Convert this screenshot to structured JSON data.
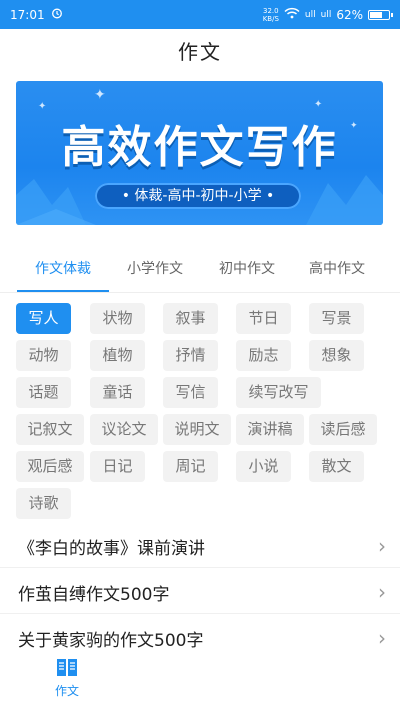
{
  "status_bar": {
    "time": "17:01",
    "alarm_icon": "alarm-icon",
    "net_speed_value": "32.0",
    "net_speed_unit": "KB/S",
    "wifi_icon": "wifi-icon",
    "signal_1": "ull",
    "signal_2": "ull",
    "battery": "62%"
  },
  "page": {
    "title": "作文"
  },
  "banner": {
    "headline": "高效作文写作",
    "subline": "• 体裁-高中-初中-小学 •"
  },
  "tabs": [
    {
      "label": "作文体裁",
      "active": true
    },
    {
      "label": "小学作文",
      "active": false
    },
    {
      "label": "初中作文",
      "active": false
    },
    {
      "label": "高中作文",
      "active": false
    }
  ],
  "tags": [
    "写人",
    "状物",
    "叙事",
    "节日",
    "写景",
    "动物",
    "植物",
    "抒情",
    "励志",
    "想象",
    "话题",
    "童话",
    "写信",
    "续写改写",
    "记叙文",
    "议论文",
    "说明文",
    "演讲稿",
    "读后感",
    "观后感",
    "日记",
    "周记",
    "小说",
    "散文",
    "诗歌"
  ],
  "active_tag": "写人",
  "articles": [
    "《李白的故事》课前演讲",
    "作茧自缚作文500字",
    "关于黄家驹的作文500字"
  ],
  "bottom_nav": {
    "label": "作文",
    "icon": "book-icon"
  },
  "colors": {
    "accent": "#1f8ff0",
    "tag_bg": "#f2f2f2"
  }
}
